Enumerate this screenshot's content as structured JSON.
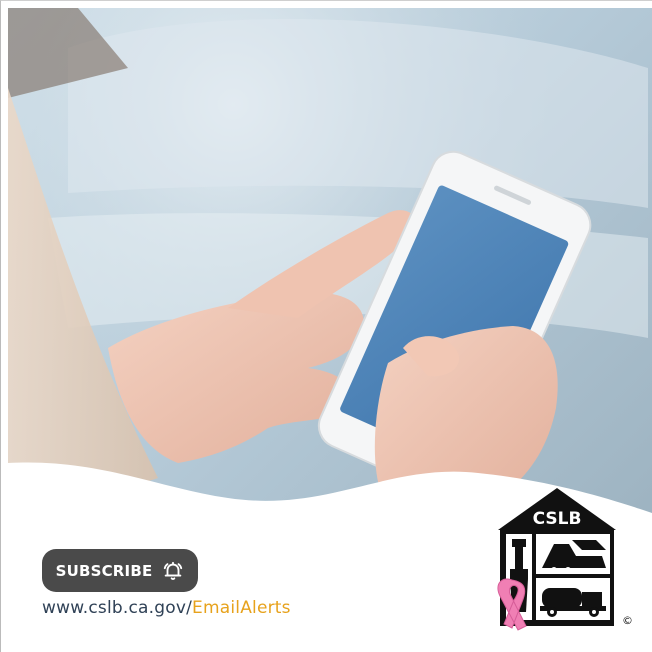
{
  "subscribe": {
    "label": "SUBSCRIBE",
    "icon": "bell-icon"
  },
  "url": {
    "base": "www.cslb.ca.gov/",
    "path": "EmailAlerts"
  },
  "logo": {
    "text": "CSLB",
    "copyright": "©",
    "ribbon": "pink-ribbon-icon"
  },
  "colors": {
    "button_bg": "#4a4a4a",
    "url_base": "#2f4156",
    "url_accent": "#e7a21c",
    "ribbon": "#f07fb4"
  }
}
